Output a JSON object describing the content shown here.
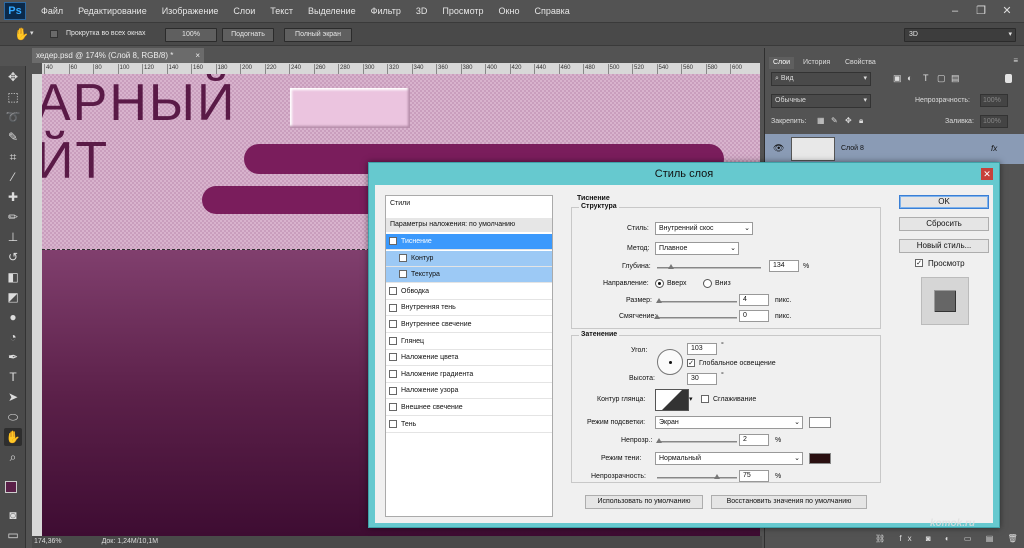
{
  "app": {
    "logo": "Ps"
  },
  "menu": [
    "Файл",
    "Редактирование",
    "Изображение",
    "Слои",
    "Текст",
    "Выделение",
    "Фильтр",
    "3D",
    "Просмотр",
    "Окно",
    "Справка"
  ],
  "options_bar": {
    "scroll_all_label": "Прокрутка во всех окнах",
    "zoom_100": "100%",
    "fit_screen": "Подогнать",
    "full_screen": "Полный экран",
    "workspace": "3D"
  },
  "document": {
    "tab_title": "хедер.psd @ 174% (Слой 8, RGB/8) *",
    "canvas_text_line1": "АРНЫЙ",
    "canvas_text_line2": "ЙТ",
    "status_zoom": "174,36%",
    "status_doc": "Док: 1,24M/10,1M"
  },
  "ruler_ticks": [
    "40",
    "60",
    "80",
    "100",
    "120",
    "140",
    "160",
    "180",
    "200",
    "220",
    "240",
    "260",
    "280",
    "300",
    "320",
    "340",
    "360",
    "380",
    "400",
    "420",
    "440",
    "460",
    "480",
    "500",
    "520",
    "540",
    "560",
    "580",
    "600"
  ],
  "layers_panel": {
    "tabs": [
      "Слои",
      "История",
      "Свойства"
    ],
    "filter": "Вид",
    "blend_mode": "Обычные",
    "opacity_label": "Непрозрачность:",
    "opacity_value": "100%",
    "lock_label": "Закрепить:",
    "fill_label": "Заливка:",
    "fill_value": "100%",
    "layer_name": "Слой 8",
    "fx": "fx"
  },
  "dialog": {
    "title": "Стиль слоя",
    "styles_header": "Стили",
    "blend_default": "Параметры наложения: по умолчанию",
    "style_items": [
      {
        "label": "Тиснение",
        "checked": true,
        "selected": true,
        "sub": false
      },
      {
        "label": "Контур",
        "checked": false,
        "selected": false,
        "sub": true
      },
      {
        "label": "Текстура",
        "checked": false,
        "selected": false,
        "sub": true
      },
      {
        "label": "Обводка",
        "checked": false,
        "selected": false,
        "sub": false
      },
      {
        "label": "Внутренняя тень",
        "checked": false,
        "selected": false,
        "sub": false
      },
      {
        "label": "Внутреннее свечение",
        "checked": false,
        "selected": false,
        "sub": false
      },
      {
        "label": "Глянец",
        "checked": false,
        "selected": false,
        "sub": false
      },
      {
        "label": "Наложение цвета",
        "checked": false,
        "selected": false,
        "sub": false
      },
      {
        "label": "Наложение градиента",
        "checked": false,
        "selected": false,
        "sub": false
      },
      {
        "label": "Наложение узора",
        "checked": false,
        "selected": false,
        "sub": false
      },
      {
        "label": "Внешнее свечение",
        "checked": false,
        "selected": false,
        "sub": false
      },
      {
        "label": "Тень",
        "checked": false,
        "selected": false,
        "sub": false
      }
    ],
    "section_title": "Тиснение",
    "structure": {
      "title": "Структура",
      "style_label": "Стиль:",
      "style_value": "Внутренний скос",
      "method_label": "Метод:",
      "method_value": "Плавное",
      "depth_label": "Глубина:",
      "depth_value": "134",
      "depth_unit": "%",
      "depth_pct": 0.134,
      "direction_label": "Направление:",
      "dir_up": "Вверх",
      "dir_down": "Вниз",
      "size_label": "Размер:",
      "size_value": "4",
      "size_unit": "пикс.",
      "size_pct": 0.02,
      "soften_label": "Смягчение:",
      "soften_value": "0",
      "soften_unit": "пикс.",
      "soften_pct": 0.0
    },
    "shading": {
      "title": "Затенение",
      "angle_label": "Угол:",
      "angle_value": "103",
      "angle_unit": "°",
      "global_light": "Глобальное освещение",
      "altitude_label": "Высота:",
      "altitude_value": "30",
      "altitude_unit": "°",
      "gloss_label": "Контур глянца:",
      "antialias": "Сглаживание",
      "highlight_label": "Режим подсветки:",
      "highlight_value": "Экран",
      "highlight_color": "#ffffff",
      "hl_opacity_label": "Непрозр.:",
      "hl_opacity_value": "2",
      "hl_opacity_unit": "%",
      "hl_pct": 0.02,
      "shadow_label": "Режим тени:",
      "shadow_value": "Нормальный",
      "shadow_color": "#2a0f10",
      "sh_opacity_label": "Непрозрачность:",
      "sh_opacity_value": "75",
      "sh_opacity_unit": "%",
      "sh_pct": 0.75
    },
    "make_default": "Использовать по умолчанию",
    "reset_default": "Восстановить значения по умолчанию",
    "ok": "OK",
    "cancel": "Сбросить",
    "new_style": "Новый стиль...",
    "preview": "Просмотр"
  },
  "watermark": "komok.ru"
}
